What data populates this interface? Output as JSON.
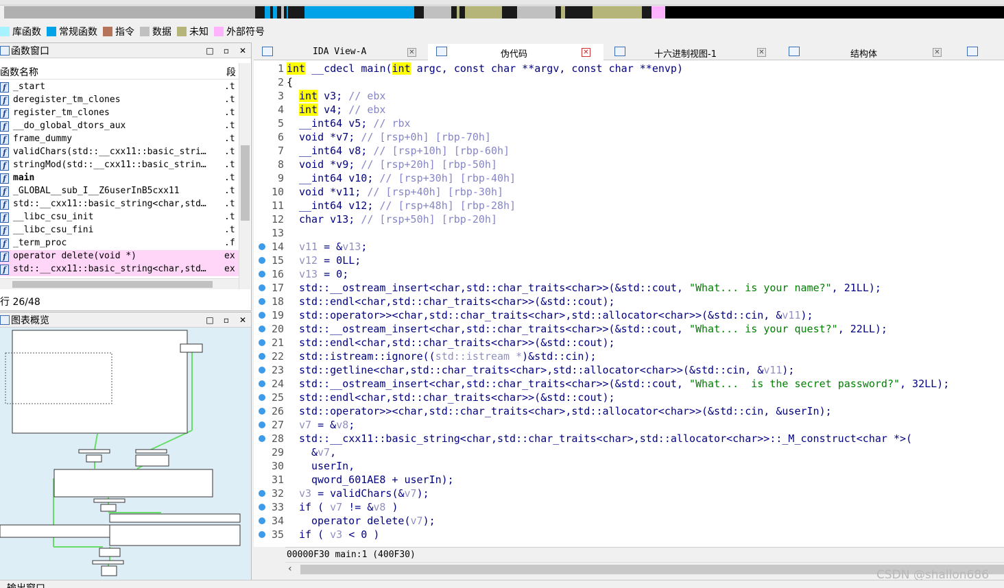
{
  "legend": [
    {
      "label": "库函数",
      "color": "#a6f2ff"
    },
    {
      "label": "常规函数",
      "color": "#00a2e8"
    },
    {
      "label": "指令",
      "color": "#b5735a"
    },
    {
      "label": "数据",
      "color": "#c0c0c0"
    },
    {
      "label": "未知",
      "color": "#b5b57a"
    },
    {
      "label": "外部符号",
      "color": "#ffb3ff"
    }
  ],
  "functions_window": {
    "title": "函数窗口",
    "col_name": "函数名称",
    "col_seg": "段",
    "rows": [
      {
        "name": "_start",
        "seg": ".t"
      },
      {
        "name": "deregister_tm_clones",
        "seg": ".t"
      },
      {
        "name": "register_tm_clones",
        "seg": ".t"
      },
      {
        "name": "__do_global_dtors_aux",
        "seg": ".t"
      },
      {
        "name": "frame_dummy",
        "seg": ".t"
      },
      {
        "name": "validChars(std::__cxx11::basic_stri…",
        "seg": ".t"
      },
      {
        "name": "stringMod(std::__cxx11::basic_strin…",
        "seg": ".t"
      },
      {
        "name": "main",
        "seg": ".t"
      },
      {
        "name": "_GLOBAL__sub_I__Z6userInB5cxx11",
        "seg": ".t"
      },
      {
        "name": "std::__cxx11::basic_string<char,std…",
        "seg": ".t"
      },
      {
        "name": "__libc_csu_init",
        "seg": ".t"
      },
      {
        "name": "__libc_csu_fini",
        "seg": ".t"
      },
      {
        "name": "_term_proc",
        "seg": ".f"
      },
      {
        "name": "operator delete(void *)",
        "seg": "ex"
      },
      {
        "name": "std::__cxx11::basic_string<char,std…",
        "seg": "ex"
      }
    ],
    "count": "行 26/48"
  },
  "graph_window": {
    "title": "图表概览"
  },
  "tabs": [
    {
      "label": "IDA View-A"
    },
    {
      "label": "伪代码"
    },
    {
      "label": "十六进制视图-1"
    },
    {
      "label": "结构体"
    }
  ],
  "code_lines": [
    {
      "n": "1",
      "dot": false
    },
    {
      "n": "2",
      "dot": false,
      "text": "{"
    },
    {
      "n": "3",
      "dot": false
    },
    {
      "n": "4",
      "dot": false
    },
    {
      "n": "5",
      "dot": false
    },
    {
      "n": "6",
      "dot": false
    },
    {
      "n": "7",
      "dot": false
    },
    {
      "n": "8",
      "dot": false
    },
    {
      "n": "9",
      "dot": false
    },
    {
      "n": "10",
      "dot": false
    },
    {
      "n": "11",
      "dot": false
    },
    {
      "n": "12",
      "dot": false
    },
    {
      "n": "13",
      "dot": false
    },
    {
      "n": "14",
      "dot": true
    },
    {
      "n": "15",
      "dot": true
    },
    {
      "n": "16",
      "dot": true
    },
    {
      "n": "17",
      "dot": true
    },
    {
      "n": "18",
      "dot": true
    },
    {
      "n": "19",
      "dot": true
    },
    {
      "n": "20",
      "dot": true
    },
    {
      "n": "21",
      "dot": true
    },
    {
      "n": "22",
      "dot": true
    },
    {
      "n": "23",
      "dot": true
    },
    {
      "n": "24",
      "dot": true
    },
    {
      "n": "25",
      "dot": true
    },
    {
      "n": "26",
      "dot": true
    },
    {
      "n": "27",
      "dot": true
    },
    {
      "n": "28",
      "dot": true
    },
    {
      "n": "29",
      "dot": false
    },
    {
      "n": "30",
      "dot": false
    },
    {
      "n": "31",
      "dot": false
    },
    {
      "n": "32",
      "dot": true
    },
    {
      "n": "33",
      "dot": true
    },
    {
      "n": "34",
      "dot": true
    },
    {
      "n": "35",
      "dot": true
    }
  ],
  "code_text": {
    "l1": [
      "int",
      " __cdecl main(",
      "int",
      " argc, const char **argv, const char **envp)"
    ],
    "l3": [
      "int",
      " v3; ",
      "// ebx"
    ],
    "l4": [
      "int",
      " v4; ",
      "// ebx"
    ],
    "l5": [
      "__int64 v5; ",
      "// rbx"
    ],
    "l6": [
      "void *v7; ",
      "// [rsp+0h] [rbp-70h]"
    ],
    "l7": [
      "__int64 v8; ",
      "// [rsp+10h] [rbp-60h]"
    ],
    "l8": [
      "void *v9; ",
      "// [rsp+20h] [rbp-50h]"
    ],
    "l9": [
      "__int64 v10; ",
      "// [rsp+30h] [rbp-40h]"
    ],
    "l10": [
      "void *v11; ",
      "// [rsp+40h] [rbp-30h]"
    ],
    "l11": [
      "__int64 v12; ",
      "// [rsp+48h] [rbp-28h]"
    ],
    "l12": [
      "char v13; ",
      "// [rsp+50h] [rbp-20h]"
    ],
    "l14": [
      "v11",
      " = &",
      "v13",
      ";"
    ],
    "l15": [
      "v12",
      " = 0LL;"
    ],
    "l16": [
      "v13",
      " = 0;"
    ],
    "l17": [
      "std::__ostream_insert<char,std::char_traits<char>>(&std::cout, ",
      "\"What... is your name?\"",
      ", 21LL);"
    ],
    "l18": [
      "std::endl<char,std::char_traits<char>>(&std::cout);"
    ],
    "l19": [
      "std::operator>><char,std::char_traits<char>,std::allocator<char>>(&std::cin, &",
      "v11",
      ");"
    ],
    "l20": [
      "std::__ostream_insert<char,std::char_traits<char>>(&std::cout, ",
      "\"What... is your quest?\"",
      ", 22LL);"
    ],
    "l21": [
      "std::endl<char,std::char_traits<char>>(&std::cout);"
    ],
    "l22": [
      "std::istream::ignore((",
      "std::istream *",
      ")&std::cin);"
    ],
    "l23": [
      "std::getline<char,std::char_traits<char>,std::allocator<char>>(&std::cin, &",
      "v11",
      ");"
    ],
    "l24": [
      "std::__ostream_insert<char,std::char_traits<char>>(&std::cout, ",
      "\"What...  is the secret password?\"",
      ", 32LL);"
    ],
    "l25": [
      "std::endl<char,std::char_traits<char>>(&std::cout);"
    ],
    "l26": [
      "std::operator>><char,std::char_traits<char>,std::allocator<char>>(&std::cin, &userIn);"
    ],
    "l27": [
      "v7",
      " = &",
      "v8",
      ";"
    ],
    "l28": [
      "std::__cxx11::basic_string<char,std::char_traits<char>,std::allocator<char>>::_M_construct<char *>("
    ],
    "l29": [
      "&",
      "v7",
      ","
    ],
    "l30": [
      "userIn,"
    ],
    "l31": [
      "qword_601AE8 + userIn);"
    ],
    "l32": [
      "v3",
      " = validChars(&",
      "v7",
      ");"
    ],
    "l33": [
      "if ( ",
      "v7",
      " != &",
      "v8",
      " )"
    ],
    "l34": [
      "operator delete(",
      "v7",
      ");"
    ],
    "l35": [
      "if ( ",
      "v3",
      " < 0 )"
    ]
  },
  "status": "00000F30 main:1 (400F30)",
  "watermark": "CSDN @shallon686",
  "output_window": {
    "title": "输出窗口"
  }
}
